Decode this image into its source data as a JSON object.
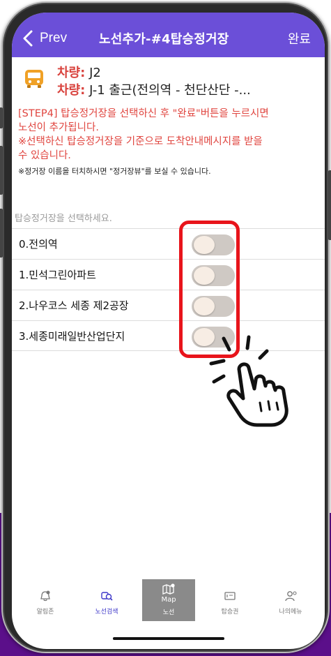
{
  "nav": {
    "back_label": "Prev",
    "title": "노선추가-#4탑승정거장",
    "done_label": "완료"
  },
  "bus": {
    "line1_label": "차량:",
    "line1_value": "J2",
    "line2_label": "차량:",
    "line2_value": "J-1 출근(전의역 - 천단산단 -..."
  },
  "instructions": {
    "step_lines": [
      "[STEP4] 탑승정거장을 선택하신 후 \"완료\"버튼을 누르시면",
      "노선이 추가됩니다.",
      "※선택하신 탑승정거장을 기준으로 도착안내메시지를 받을",
      "수 있습니다."
    ],
    "hint": "※정거장 이름을 터치하시면 \"정거장뷰\"를 보실 수 있습니다."
  },
  "list": {
    "header": "탑승정거장을 선택하세요.",
    "stops": [
      {
        "name": "0.전의역",
        "selected": false
      },
      {
        "name": "1.민석그린아파트",
        "selected": false
      },
      {
        "name": "2.나우코스 세종 제2공장",
        "selected": false
      },
      {
        "name": "3.세종미래일반산업단지",
        "selected": false
      }
    ]
  },
  "tabbar": {
    "tabs": [
      {
        "label": "알림존",
        "icon": "bell-icon"
      },
      {
        "label": "노선검색",
        "icon": "bus-search-icon"
      },
      {
        "label": "노선",
        "icon": "map-icon",
        "badge_text": "Map"
      },
      {
        "label": "탑승권",
        "icon": "ticket-icon"
      },
      {
        "label": "나의메뉴",
        "icon": "person-icon"
      }
    ]
  },
  "colors": {
    "nav_bg": "#6b4fd8",
    "step_text": "#e0453f",
    "highlight": "#e8141b",
    "backdrop": "#5b0f8a"
  }
}
